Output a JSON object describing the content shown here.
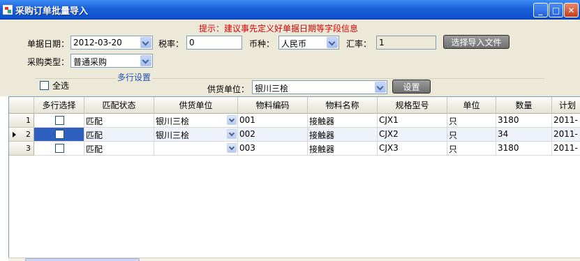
{
  "window": {
    "title": "采购订单批量导入",
    "controls": {
      "minimize": "_",
      "maximize": "□",
      "close": "✕"
    }
  },
  "form": {
    "hint": "提示：建议事先定义好单据日期等字段信息",
    "doc_date_label": "单据日期：",
    "doc_date_value": "2012-03-20",
    "tax_rate_label": "税率：",
    "tax_rate_value": "0",
    "currency_label": "币种：",
    "currency_value": "人民币",
    "exchange_rate_label": "汇率：",
    "exchange_rate_value": "1",
    "import_button": "选择导入文件",
    "purchase_type_label": "采购类型：",
    "purchase_type_value": "普通采购",
    "multi_row_group_label": "多行设置",
    "select_all_label": "全选",
    "supplier_label": "供货单位：",
    "supplier_value": "银川三桧",
    "set_button": "设置"
  },
  "grid": {
    "columns": [
      "多行选择",
      "匹配状态",
      "供货单位",
      "物料编码",
      "物料名称",
      "规格型号",
      "单位",
      "数量",
      "计划"
    ],
    "rows": [
      {
        "num": "1",
        "status": "匹配",
        "supplier": "银川三桧",
        "code": "001",
        "name": "接触器",
        "spec": "CJX1",
        "unit": "只",
        "qty": "3180",
        "plan": "2011-"
      },
      {
        "num": "2",
        "status": "匹配",
        "supplier": "银川三桧",
        "code": "002",
        "name": "接触器",
        "spec": "CJX2",
        "unit": "只",
        "qty": "34",
        "plan": "2011-"
      },
      {
        "num": "3",
        "status": "匹配",
        "supplier": "",
        "code": "003",
        "name": "接触器",
        "spec": "CJX3",
        "unit": "只",
        "qty": "3180",
        "plan": "2011-"
      }
    ]
  }
}
